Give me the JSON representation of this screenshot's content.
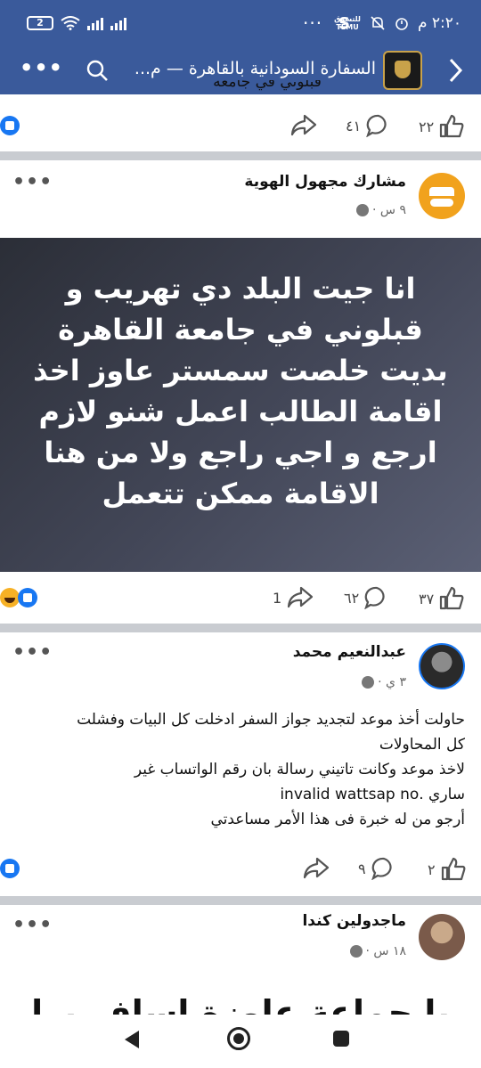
{
  "status_bar": {
    "time": "٢:٢٠ م",
    "battery": "2",
    "temu": "للتسوق\nTEMU",
    "dots": "···",
    "s_icon": "S"
  },
  "header": {
    "title": "السفارة السودانية بالقاهرة — م...",
    "more": "•••"
  },
  "post0": {
    "partial_text": "فبلوني في جامعه",
    "likes": "٢٢",
    "comments": "٤١"
  },
  "post1": {
    "author": "مشارك مجهول الهوية",
    "time": "٩ س ·",
    "more": "•••",
    "banner_lines": [
      "انا جيت البلد دي تهريب و",
      "قبلوني في جامعة القاهرة",
      "بديت خلصت سمستر عاوز اخذ",
      "اقامة الطالب اعمل شنو لازم",
      "ارجع و اجي راجع ولا من هنا",
      "الاقامة ممكن تتعمل"
    ],
    "likes": "٣٧",
    "comments": "٦٢",
    "shares": "1"
  },
  "post2": {
    "author": "عبدالنعيم محمد",
    "time": "٣ ي ·",
    "more": "•••",
    "text_lines": [
      "حاولت أخذ موعد لتجديد جواز السفر ادخلت كل البيات وفشلت",
      "كل المحاولات",
      "لاخذ موعد وكانت تاتيني رسالة بان رقم الواتساب غير",
      "ساري .invalid wattsap no",
      "أرجو من له خبرة فى هذا الأمر مساعدتي"
    ],
    "likes": "٢",
    "comments": "٩"
  },
  "post3": {
    "author": "ماجدولين كندا",
    "time": "١٨ س ·",
    "more": "•••",
    "big_text": "يا جماعة عاوزة اسافر برا مصر"
  },
  "colors": {
    "header": "#3a5a9b",
    "reaction_like": "#1877f2",
    "separator": "#c9ccd1"
  }
}
